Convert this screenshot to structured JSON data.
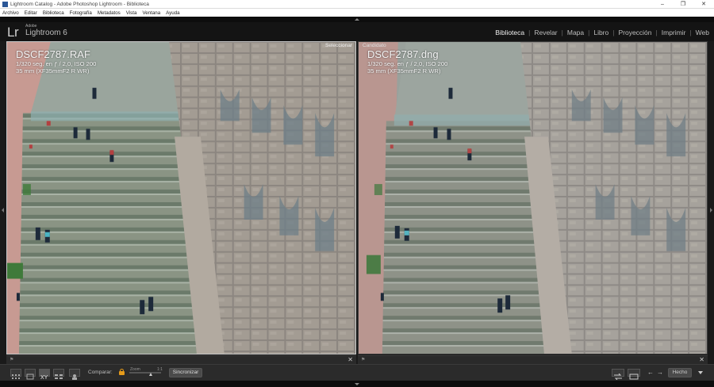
{
  "window": {
    "title": "Lightroom Catalog - Adobe Photoshop Lightroom - Biblioteca",
    "controls": [
      "minimize",
      "maximize",
      "close"
    ]
  },
  "menu": [
    "Archivo",
    "Editar",
    "Biblioteca",
    "Fotografía",
    "Metadatos",
    "Vista",
    "Ventana",
    "Ayuda"
  ],
  "identity": {
    "logo": "Lr",
    "adobe": "Adobe",
    "product": "Lightroom 6"
  },
  "modules": [
    "Biblioteca",
    "Revelar",
    "Mapa",
    "Libro",
    "Proyección",
    "Imprimir",
    "Web"
  ],
  "active_module": "Biblioteca",
  "compare": {
    "select": {
      "label": "Seleccionar",
      "filename": "DSCF2787.RAF",
      "exposure": "1/320 seg. en ƒ / 2,0, ISO 200",
      "lens": "35 mm (XF35mmF2 R WR)"
    },
    "candidate": {
      "label": "Candidato",
      "filename": "DSCF2787.dng",
      "exposure": "1/320 seg. en ƒ / 2,0, ISO 200",
      "lens": "35 mm (XF35mmF2 R WR)"
    }
  },
  "toolbar": {
    "compare_label": "Comparar:",
    "zoom_low": "Zoom",
    "zoom_high": "1:1",
    "sync_button": "Sincronizar",
    "done_button": "Hecho"
  },
  "colors": {
    "chrome_bg": "#1a1a1a",
    "lock": "#e49a1a"
  }
}
